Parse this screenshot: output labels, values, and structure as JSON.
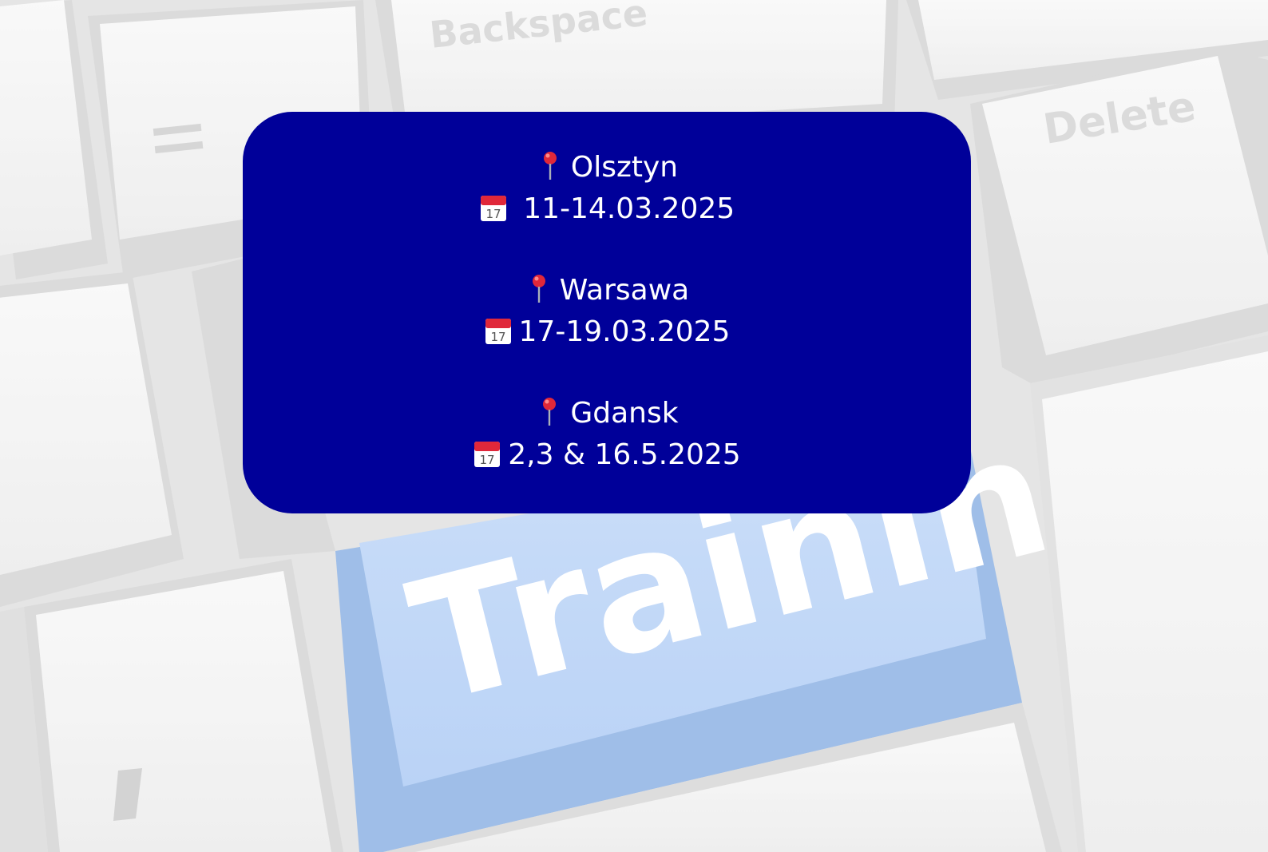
{
  "background": {
    "keys": {
      "backspace_label": "Backspace",
      "delete_label": "Delete",
      "training_label": "Training"
    },
    "colors": {
      "key_face": "#f2f2f2",
      "key_shadow": "#d9d9d9",
      "training_key": "#a9c8f5",
      "training_key_shadow": "#7fa8e0"
    }
  },
  "card": {
    "background_color": "#000099",
    "text_color": "#ffffff",
    "entries": [
      {
        "pin_icon": "round-pushpin-icon",
        "city": "Olsztyn",
        "calendar_icon": "calendar-icon",
        "dates": " 11-14.03.2025"
      },
      {
        "pin_icon": "round-pushpin-icon",
        "city": "Warsawa",
        "calendar_icon": "calendar-icon",
        "dates": "17-19.03.2025"
      },
      {
        "pin_icon": "round-pushpin-icon",
        "city": "Gdansk",
        "calendar_icon": "calendar-icon",
        "dates": "2,3 & 16.5.2025"
      }
    ]
  }
}
